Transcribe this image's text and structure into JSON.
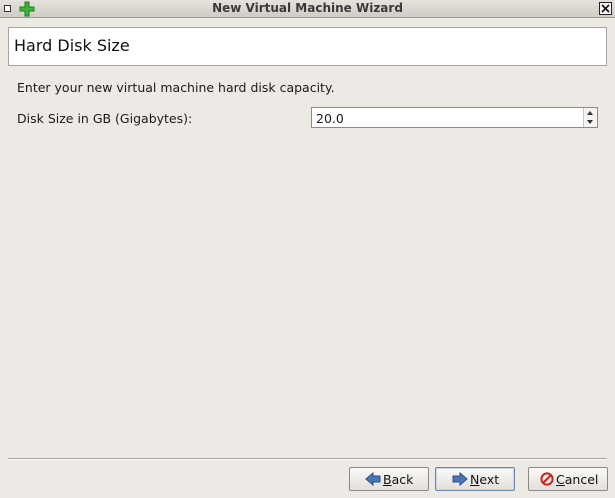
{
  "window": {
    "title": "New Virtual Machine Wizard"
  },
  "header": {
    "title": "Hard Disk Size"
  },
  "main": {
    "description": "Enter your new virtual machine hard disk capacity.",
    "disk_size_label": "Disk Size in GB (Gigabytes):",
    "disk_size_value": "20.0"
  },
  "buttons": {
    "back": {
      "mnemonic": "B",
      "rest": "ack"
    },
    "next": {
      "mnemonic": "N",
      "rest": "ext"
    },
    "cancel": {
      "mnemonic": "C",
      "rest": "ancel"
    }
  },
  "icons": {
    "app": "green-plus-icon",
    "menu": "window-menu-icon",
    "close": "close-icon",
    "back": "back-arrow-icon",
    "next": "next-arrow-icon",
    "cancel": "cancel-icon",
    "spin_up": "spin-up-arrow-icon",
    "spin_down": "spin-down-arrow-icon"
  },
  "colors": {
    "background": "#edeae5",
    "app_icon": "#3cb43c",
    "nav_arrow": "#4a76b8",
    "cancel_icon": "#c8231b"
  }
}
